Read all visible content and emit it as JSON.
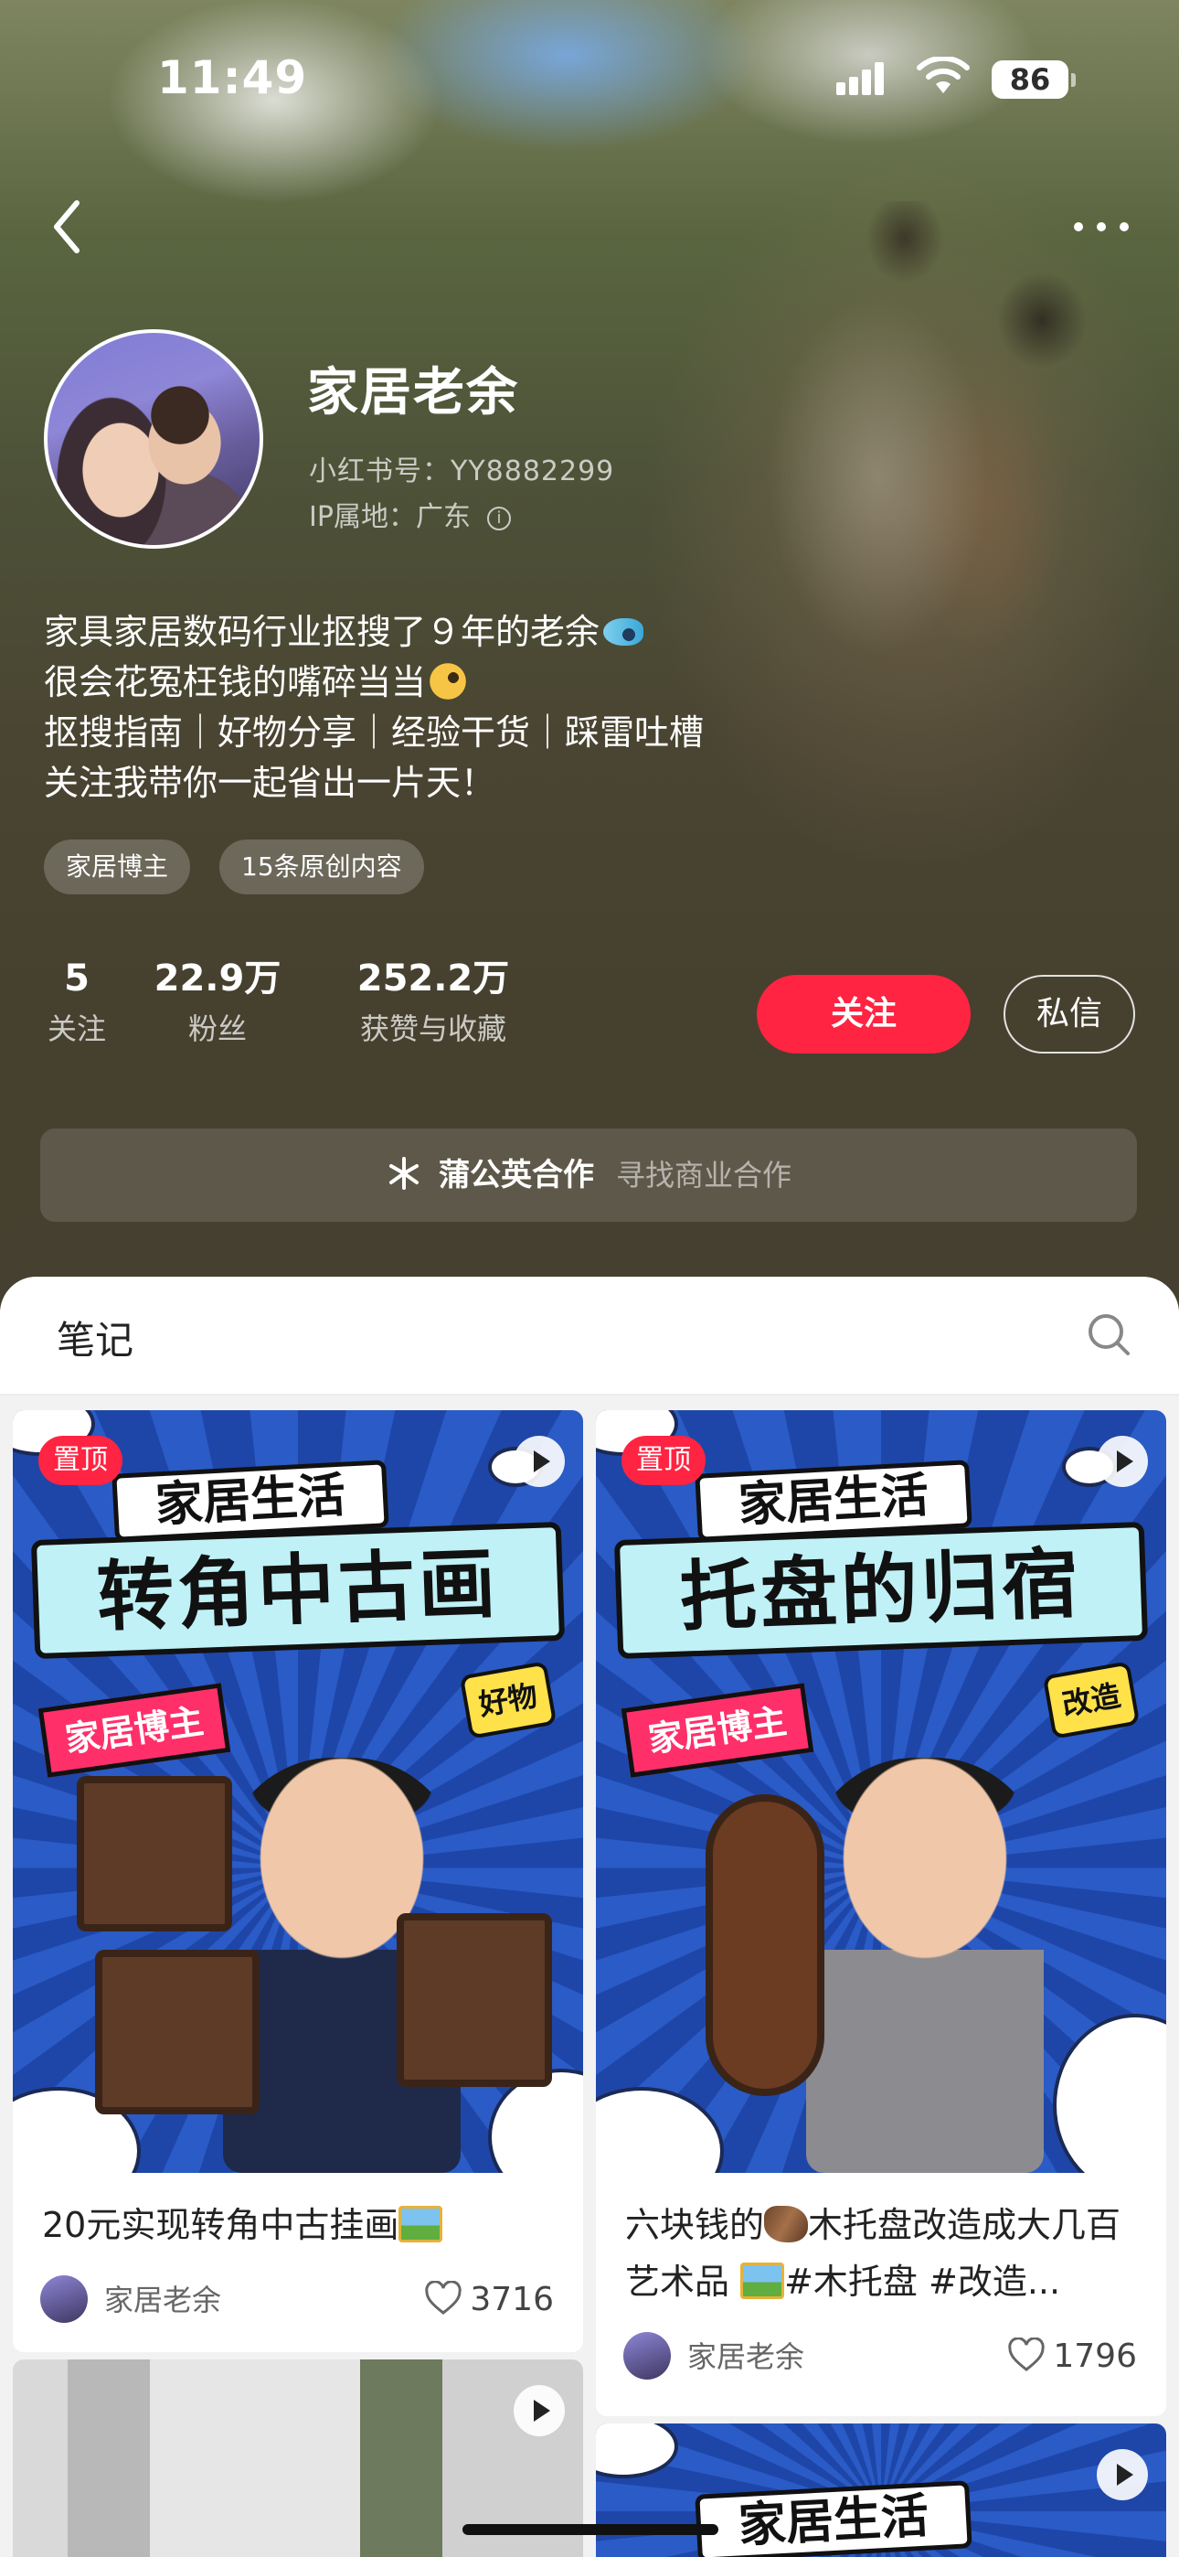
{
  "status_bar": {
    "time": "11:49",
    "battery": "86"
  },
  "profile": {
    "name": "家居老余",
    "red_id": "小红书号：YY8882299",
    "ip_location": "IP属地：广东",
    "bio": [
      "家具家居数码行业抠搜了９年的老余",
      "很会花冤枉钱的嘴碎当当",
      "抠搜指南｜好物分享｜经验干货｜踩雷吐槽",
      "关注我带你一起省出一片天！"
    ],
    "tags": [
      "家居博主",
      "15条原创内容"
    ],
    "stats": [
      {
        "value": "5",
        "label": "关注"
      },
      {
        "value": "22.9万",
        "label": "粉丝"
      },
      {
        "value": "252.2万",
        "label": "获赞与收藏"
      }
    ],
    "follow_label": "关注",
    "message_label": "私信"
  },
  "collab": {
    "title": "蒲公英合作",
    "subtitle": "寻找商业合作"
  },
  "notes": {
    "tab_label": "笔记",
    "cards": [
      {
        "pinned_label": "置顶",
        "cover_header": "家居生活",
        "cover_title": "转角中古画",
        "cover_badge": "家居博主",
        "cover_sticker": "好物",
        "title": "20元实现转角中古挂画",
        "author": "家居老余",
        "likes": "3716"
      },
      {
        "pinned_label": "置顶",
        "cover_header": "家居生活",
        "cover_title": "托盘的归宿",
        "cover_badge": "家居博主",
        "cover_sticker": "改造",
        "title_part1": "六块钱的",
        "title_part2": "木托盘改造成大几百艺术品 ",
        "title_part3": "#木托盘 #改造...",
        "author": "家居老余",
        "likes": "1796"
      },
      {
        "cover_header": "家居生活"
      }
    ]
  },
  "colors": {
    "accent": "#ff2442",
    "cover_blue": "#1e46a8"
  },
  "icons": [
    "back-icon",
    "more-icon",
    "search-icon",
    "play-icon",
    "heart-icon",
    "dandelion-icon",
    "info-icon"
  ]
}
